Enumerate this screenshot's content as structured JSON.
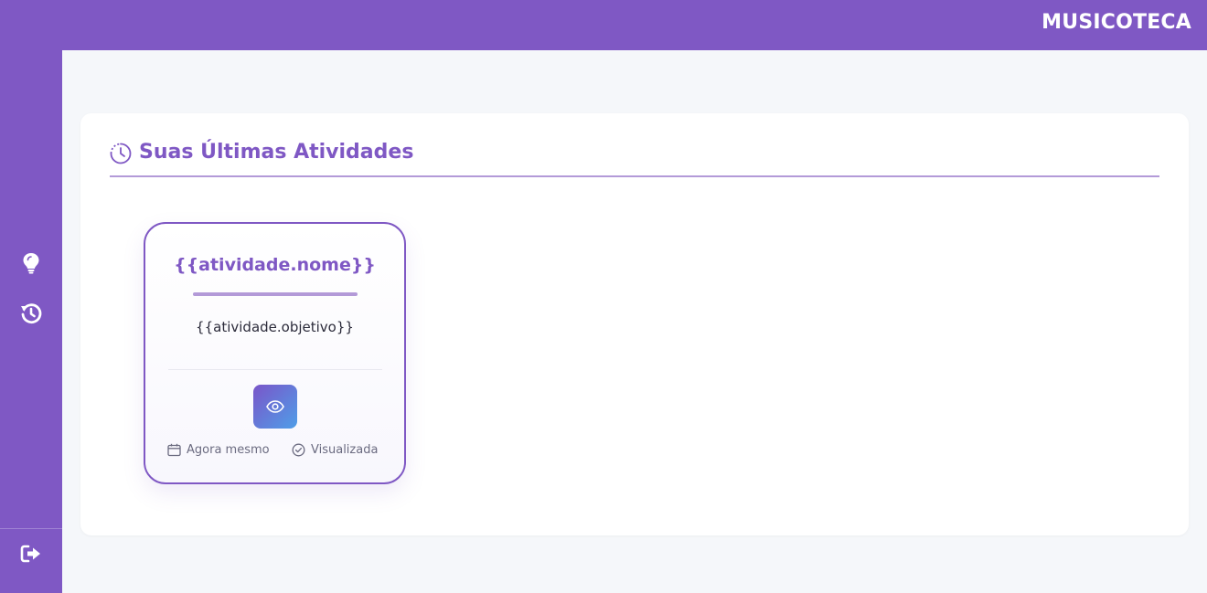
{
  "app": {
    "brand": "MUSICOTECA"
  },
  "colors": {
    "primary": "#7f58c4",
    "accent_light": "#b39ad8",
    "background": "#f5f7fa"
  },
  "sidebar": {
    "items": [
      {
        "icon": "lightbulb-icon"
      },
      {
        "icon": "history-icon"
      }
    ],
    "logout_icon": "logout-icon"
  },
  "section": {
    "title": "Suas Últimas Atividades",
    "icon": "clock-icon"
  },
  "activity": {
    "name": "{{atividade.nome}}",
    "objective": "{{atividade.objetivo}}",
    "view_icon": "eye-icon",
    "date_label": "Agora mesmo",
    "status_label": "Visualizada"
  }
}
